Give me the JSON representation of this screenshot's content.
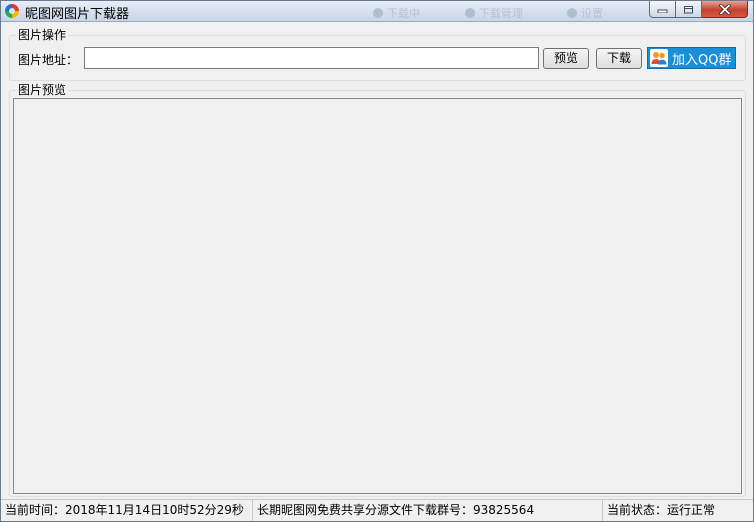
{
  "window": {
    "title": "昵图网图片下载器",
    "ghost_tabs": [
      "下载中",
      "下载管理",
      "设置"
    ]
  },
  "operations": {
    "legend": "图片操作",
    "url_label": "图片地址：",
    "url_value": "",
    "preview_button": "预览",
    "download_button": "下载",
    "qq_button": "加入QQ群"
  },
  "preview": {
    "legend": "图片预览"
  },
  "status": {
    "time": "当前时间：2018年11月14日10时52分29秒",
    "group": "长期昵图网免费共享分源文件下载群号：93825564",
    "state": "当前状态：运行正常"
  },
  "colors": {
    "qq_button_bg": "#1a8fd8",
    "close_button": "#c4412f",
    "window_bg": "#f0f0f0"
  },
  "icons": {
    "app": "app-logo-icon",
    "qq": "qq-group-icon",
    "minimize": "minimize-icon",
    "maximize": "maximize-icon",
    "close": "close-icon"
  }
}
